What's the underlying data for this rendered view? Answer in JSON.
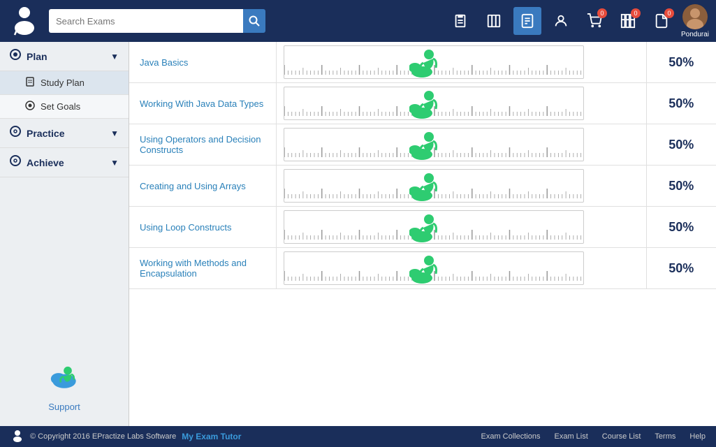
{
  "header": {
    "search_placeholder": "Search Exams",
    "icons": [
      {
        "name": "clipboard-icon",
        "symbol": "📋",
        "active": false
      },
      {
        "name": "book-icon",
        "symbol": "📚",
        "active": false
      },
      {
        "name": "document-icon",
        "symbol": "📄",
        "active": true
      },
      {
        "name": "user-icon",
        "symbol": "👤",
        "active": false
      },
      {
        "name": "cart-icon",
        "symbol": "🛒",
        "active": false,
        "badge": "0"
      },
      {
        "name": "shelves-icon",
        "symbol": "🗂",
        "active": false,
        "badge": "0"
      },
      {
        "name": "file-icon",
        "symbol": "📁",
        "active": false,
        "badge": "0"
      }
    ],
    "username": "Pondurai"
  },
  "sidebar": {
    "items": [
      {
        "id": "plan",
        "label": "Plan",
        "icon": "⊙",
        "expandable": true
      },
      {
        "id": "study-plan",
        "label": "Study Plan",
        "icon": "📋",
        "sub": true
      },
      {
        "id": "set-goals",
        "label": "Set Goals",
        "icon": "⊙",
        "sub": true
      },
      {
        "id": "practice",
        "label": "Practice",
        "icon": "◎",
        "expandable": true
      },
      {
        "id": "achieve",
        "label": "Achieve",
        "icon": "◎",
        "expandable": true
      }
    ],
    "support_label": "Support"
  },
  "content": {
    "rows": [
      {
        "topic": "Java Basics",
        "score": "50%"
      },
      {
        "topic": "Working With Java Data Types",
        "score": "50%"
      },
      {
        "topic": "Using Operators and Decision Constructs",
        "score": "50%"
      },
      {
        "topic": "Creating and Using Arrays",
        "score": "50%"
      },
      {
        "topic": "Using Loop Constructs",
        "score": "50%"
      },
      {
        "topic": "Working with Methods and Encapsulation",
        "score": "50%"
      }
    ]
  },
  "footer": {
    "copyright": "© Copyright 2016 EPractize Labs Software",
    "brand": "My Exam Tutor",
    "links": [
      "Exam Collections",
      "Exam List",
      "Course List",
      "Terms",
      "Help"
    ]
  }
}
